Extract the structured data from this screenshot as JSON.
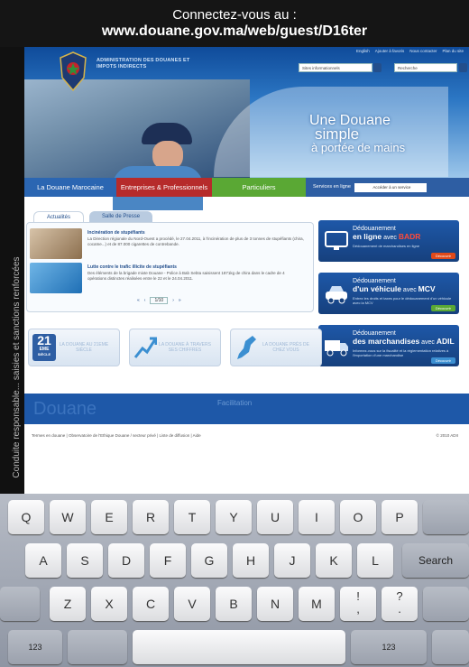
{
  "banner": {
    "line1": "Connectez-vous au :",
    "line2": "www.douane.gov.ma/web/guest/D16ter",
    "side": "Conduite responsable... saisies et sanctions renforcées"
  },
  "site": {
    "org_name": "ADMINISTRATION DES DOUANES ET IMPOTS INDIRECTS",
    "top_links": [
      "English",
      "Ajouter à favoris",
      "Nous contacter",
      "Plan du site"
    ],
    "sites_select": "Sites informationnels",
    "search_placeholder": "Recherche",
    "tagline": {
      "l1": "Une Douane",
      "l2": "simple",
      "l3": "à portée de mains"
    },
    "nav": {
      "item1": "La Douane Marocaine",
      "item2": "Entreprises & Professionnels",
      "item3": "Particuliers",
      "services_label": "Services en ligne",
      "services_select": "Accéder à un service"
    },
    "tabs": {
      "active": "Actualités",
      "inactive": "Salle de Presse"
    },
    "news": [
      {
        "title": "Incinération de stupéfiants",
        "text": "La Direction régionale du Nord-Ouest a procédé, le 27.04.2011, à l'incinération de plus de 3 tonnes de stupéfiants (chira, cocaïne...) et de 87.000 cigarettes de contrebande."
      },
      {
        "title": "Lutte contre le trafic illicite de stupéfiants",
        "text": "Des éléments de la brigade mixte Douane - Police à Bab Sebta saisissent 1871kg de chira dans le cadre de 4 opérations distinctes réalisées entre le 22 et le 24.04.2011."
      }
    ],
    "pager": {
      "page": "1/10"
    },
    "promos": [
      {
        "t1": "Dédouanement",
        "t2_pre": "en ligne",
        "t2_mid": " avec ",
        "t2_brand": "BADR",
        "sub": "Dédouanement de marchandises en ligne",
        "btn": "Découvrir",
        "accent": "#ff4a3a"
      },
      {
        "t1": "Dédouanement",
        "t2_pre": "d'un véhicule",
        "t2_mid": " avec ",
        "t2_brand": "MCV",
        "sub": "Entrez les droits et taxes pour le dédouanement d'un véhicule avec la MCV",
        "btn": "Découvrir",
        "accent": "#ffffff"
      },
      {
        "t1": "Dédouanement",
        "t2_pre": "des marchandises",
        "t2_mid": " avec ",
        "t2_brand": "ADIL",
        "sub": "Informez-vous sur la fiscalité et la réglementation relatives à l'importation d'une marchandise",
        "btn": "Découvrir",
        "accent": "#ffffff"
      }
    ],
    "cards": [
      {
        "label": "LA DOUANE AU 21EME SIÈCLE",
        "badge_n": "21",
        "badge_e": "EME",
        "badge_y": "SIÈCLE"
      },
      {
        "label": "LA DOUANE À TRAVERS SES CHIFFRES"
      },
      {
        "label": "LA DOUANE PRÈS DE CHEZ VOUS"
      }
    ],
    "band": {
      "ghost": "Douane",
      "label": "Facilitation"
    },
    "footer_links": "Termes en douane  |  Observatoire de l'Ethique Douane / secteur privé  |  Liste de diffusion  |  Aide",
    "copyright": "© 2010 ADII"
  },
  "keyboard": {
    "row1": [
      "Q",
      "W",
      "E",
      "R",
      "T",
      "Y",
      "U",
      "I",
      "O",
      "P"
    ],
    "row2": [
      "A",
      "S",
      "D",
      "F",
      "G",
      "H",
      "J",
      "K",
      "L"
    ],
    "row2_action": "Search",
    "row3": [
      "Z",
      "X",
      "C",
      "V",
      "B",
      "N",
      "M"
    ],
    "row3_punct": [
      {
        "top": "!",
        "bottom": ","
      },
      {
        "top": "?",
        "bottom": "."
      }
    ],
    "row4_left": "123",
    "row4_right": "123"
  }
}
